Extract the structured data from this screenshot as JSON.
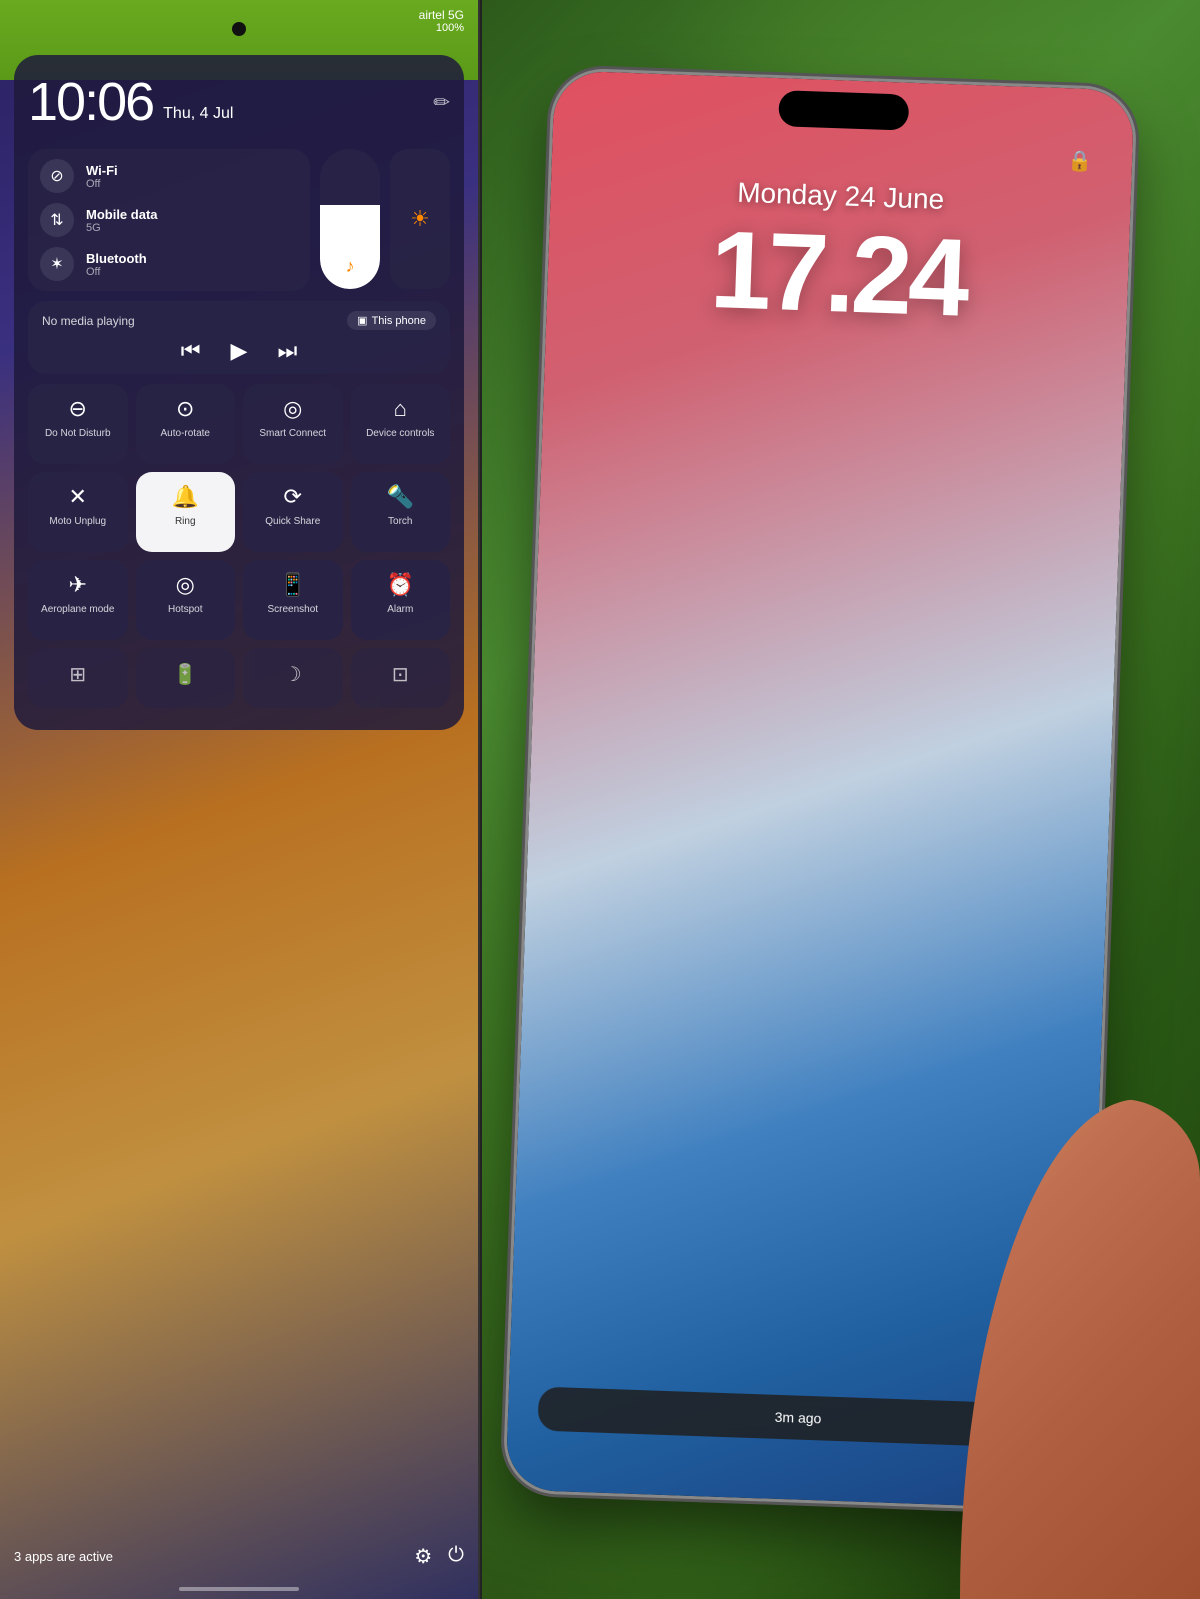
{
  "left": {
    "status": {
      "carrier": "airtel 5G",
      "battery": "100%",
      "wifi_off": "WiFi Off"
    },
    "clock": {
      "time": "10:06",
      "date": "Thu, 4 Jul",
      "edit_icon": "✏"
    },
    "network": {
      "wifi": {
        "label": "Wi-Fi",
        "sublabel": "Off",
        "icon": "⊘"
      },
      "mobile": {
        "label": "Mobile data",
        "sublabel": "5G",
        "icon": "⇅"
      },
      "bluetooth": {
        "label": "Bluetooth",
        "sublabel": "Off",
        "icon": "✶"
      }
    },
    "media": {
      "no_media": "No media playing",
      "device": "This phone",
      "prev": "⏮",
      "play": "▶",
      "next": "⏭"
    },
    "tiles": [
      {
        "icon": "⊖",
        "label": "Do Not Disturb",
        "active": false
      },
      {
        "icon": "⟳",
        "label": "Auto-rotate",
        "active": false
      },
      {
        "icon": "◎",
        "label": "Smart Connect",
        "active": false
      },
      {
        "icon": "⌂",
        "label": "Device controls",
        "active": false
      },
      {
        "icon": "✕",
        "label": "Moto Unplug",
        "active": false
      },
      {
        "icon": "🔔",
        "label": "Ring",
        "active": true
      },
      {
        "icon": "⟳",
        "label": "Quick Share",
        "active": false
      },
      {
        "icon": "🔦",
        "label": "Torch",
        "active": false
      }
    ],
    "tiles2": [
      {
        "icon": "✈",
        "label": "Aeroplane mode"
      },
      {
        "icon": "◎",
        "label": "Hotspot"
      },
      {
        "icon": "📱",
        "label": "Screenshot"
      },
      {
        "icon": "⏰",
        "label": "Alarm"
      }
    ],
    "tiles3": [
      {
        "icon": "⊞",
        "label": ""
      },
      {
        "icon": "🔋",
        "label": ""
      },
      {
        "icon": "☽",
        "label": ""
      },
      {
        "icon": "⊡",
        "label": ""
      }
    ],
    "bottom": {
      "active_apps": "3 apps are active",
      "arrow": ">",
      "settings": "⚙",
      "power": "⏻"
    }
  },
  "right": {
    "lock_icon": "🔒",
    "date": "Monday 24 June",
    "time": "17.24",
    "notification": {
      "text": "3m ago"
    }
  }
}
